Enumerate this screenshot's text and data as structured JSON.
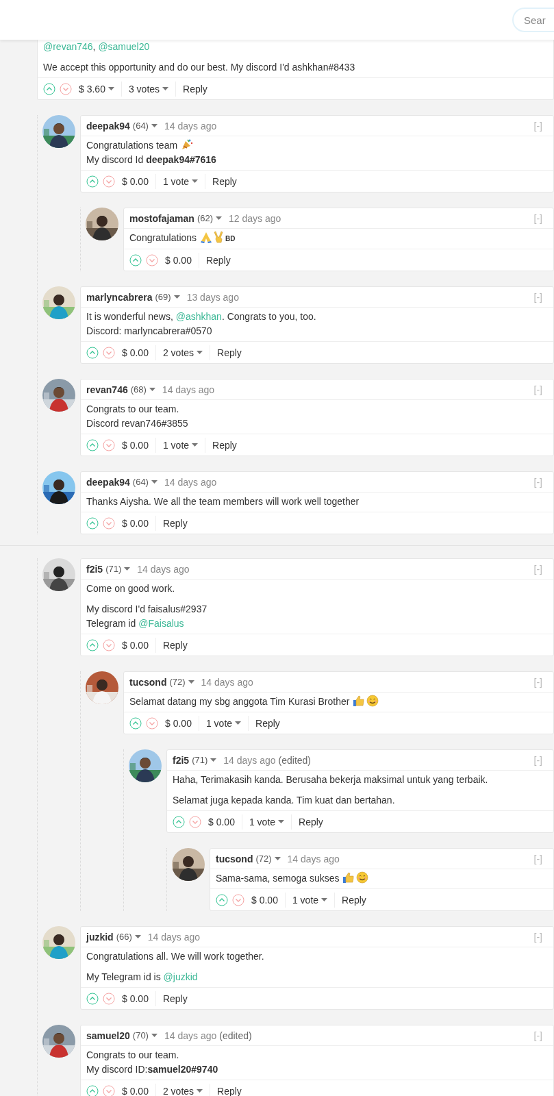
{
  "header": {
    "search": {
      "placeholder": "Sear"
    }
  },
  "threads": [
    {
      "comment": {
        "paragraphs": [
          [
            [
              {
                "kind": "link",
                "text": "@revan746"
              },
              {
                "kind": "text",
                "text": ", "
              },
              {
                "kind": "link",
                "text": "@samuel20"
              }
            ]
          ],
          [
            "We accept this opportunity and do our best. My discord I'd ashkhan#8433"
          ]
        ],
        "payout": "$ 3.60",
        "payout_menu": true,
        "votes": "3 votes",
        "reply": "Reply"
      },
      "children": [
        {
          "author": "deepak94",
          "reputation": "(64)",
          "time": "14 days ago",
          "collapse": "[-]",
          "paragraphs": [
            [
              [
                {
                  "kind": "text",
                  "text": "Congratulations team "
                },
                {
                  "kind": "party-emoji"
                }
              ],
              "My discord Id **deepak94#7616**"
            ]
          ],
          "payout": "$ 0.00",
          "payout_menu": false,
          "votes": "1 vote",
          "reply": "Reply",
          "children": [
            {
              "author": "mostofajaman",
              "reputation": "(62)",
              "time": "12 days ago",
              "collapse": "[-]",
              "paragraphs": [
                [
                  [
                    {
                      "kind": "text",
                      "text": "Congratulations "
                    },
                    {
                      "kind": "pray-emoji"
                    },
                    {
                      "kind": "victory-emoji"
                    },
                    {
                      "kind": "small",
                      "text": "BD"
                    }
                  ]
                ]
              ],
              "payout": "$ 0.00",
              "payout_menu": false,
              "reply": "Reply"
            }
          ]
        },
        {
          "author": "marlyncabrera",
          "reputation": "(69)",
          "time": "13 days ago",
          "collapse": "[-]",
          "paragraphs": [
            [
              [
                {
                  "kind": "text",
                  "text": "It is wonderful news, "
                },
                {
                  "kind": "link",
                  "text": "@ashkhan"
                },
                {
                  "kind": "text",
                  "text": ". Congrats to you, too."
                }
              ],
              "Discord: marlyncabrera#0570"
            ]
          ],
          "payout": "$ 0.00",
          "payout_menu": false,
          "votes": "2 votes",
          "reply": "Reply"
        },
        {
          "author": "revan746",
          "reputation": "(68)",
          "time": "14 days ago",
          "collapse": "[-]",
          "paragraphs": [
            [
              "Congrats to our team.",
              "Discord revan746#3855"
            ]
          ],
          "payout": "$ 0.00",
          "payout_menu": false,
          "votes": "1 vote",
          "reply": "Reply"
        },
        {
          "author": "deepak94",
          "reputation": "(64)",
          "time": "14 days ago",
          "collapse": "[-]",
          "paragraphs": [
            [
              "Thanks Aiysha. We all the team members will work well together"
            ]
          ],
          "payout": "$ 0.00",
          "payout_menu": false,
          "reply": "Reply"
        }
      ]
    },
    {
      "children": [
        {
          "author": "f2i5",
          "reputation": "(71)",
          "time": "14 days ago",
          "collapse": "[-]",
          "paragraphs": [
            [
              "Come on good work."
            ],
            [
              "My discord I'd faisalus#2937",
              [
                {
                  "kind": "text",
                  "text": "Telegram id "
                },
                {
                  "kind": "link",
                  "text": "@Faisalus"
                }
              ]
            ]
          ],
          "payout": "$ 0.00",
          "payout_menu": false,
          "reply": "Reply",
          "children": [
            {
              "author": "tucsond",
              "reputation": "(72)",
              "time": "14 days ago",
              "collapse": "[-]",
              "paragraphs": [
                [
                  [
                    {
                      "kind": "text",
                      "text": "Selamat datang my sbg anggota Tim Kurasi Brother "
                    },
                    {
                      "kind": "thumbs-emoji"
                    },
                    {
                      "kind": "smile-emoji"
                    }
                  ]
                ]
              ],
              "payout": "$ 0.00",
              "payout_menu": false,
              "votes": "1 vote",
              "reply": "Reply",
              "children": [
                {
                  "author": "f2i5",
                  "reputation": "(71)",
                  "time": "14 days ago",
                  "edited": "(edited)",
                  "collapse": "[-]",
                  "paragraphs": [
                    [
                      "Haha, Terimakasih kanda. Berusaha bekerja maksimal untuk yang terbaik."
                    ],
                    [
                      "Selamat juga kepada kanda. Tim kuat dan bertahan."
                    ]
                  ],
                  "payout": "$ 0.00",
                  "payout_menu": false,
                  "votes": "1 vote",
                  "reply": "Reply",
                  "children": [
                    {
                      "author": "tucsond",
                      "reputation": "(72)",
                      "time": "14 days ago",
                      "collapse": "[-]",
                      "paragraphs": [
                        [
                          [
                            {
                              "kind": "text",
                              "text": "Sama-sama, semoga sukses "
                            },
                            {
                              "kind": "thumbs-emoji"
                            },
                            {
                              "kind": "smile-emoji"
                            }
                          ]
                        ]
                      ],
                      "payout": "$ 0.00",
                      "payout_menu": false,
                      "votes": "1 vote",
                      "reply": "Reply"
                    }
                  ]
                }
              ]
            }
          ]
        },
        {
          "author": "juzkid",
          "reputation": "(66)",
          "time": "14 days ago",
          "collapse": "[-]",
          "paragraphs": [
            [
              "Congratulations all. We will work together."
            ],
            [
              [
                {
                  "kind": "text",
                  "text": "My Telegram id is "
                },
                {
                  "kind": "link",
                  "text": "@juzkid"
                }
              ]
            ]
          ],
          "payout": "$ 0.00",
          "payout_menu": false,
          "reply": "Reply"
        },
        {
          "author": "samuel20",
          "reputation": "(70)",
          "time": "14 days ago",
          "edited": "(edited)",
          "collapse": "[-]",
          "paragraphs": [
            [
              "Congrats to our team.",
              "My discord ID:**samuel20#9740**"
            ]
          ],
          "payout": "$ 0.00",
          "payout_menu": false,
          "votes": "2 votes",
          "reply": "Reply"
        }
      ]
    }
  ]
}
